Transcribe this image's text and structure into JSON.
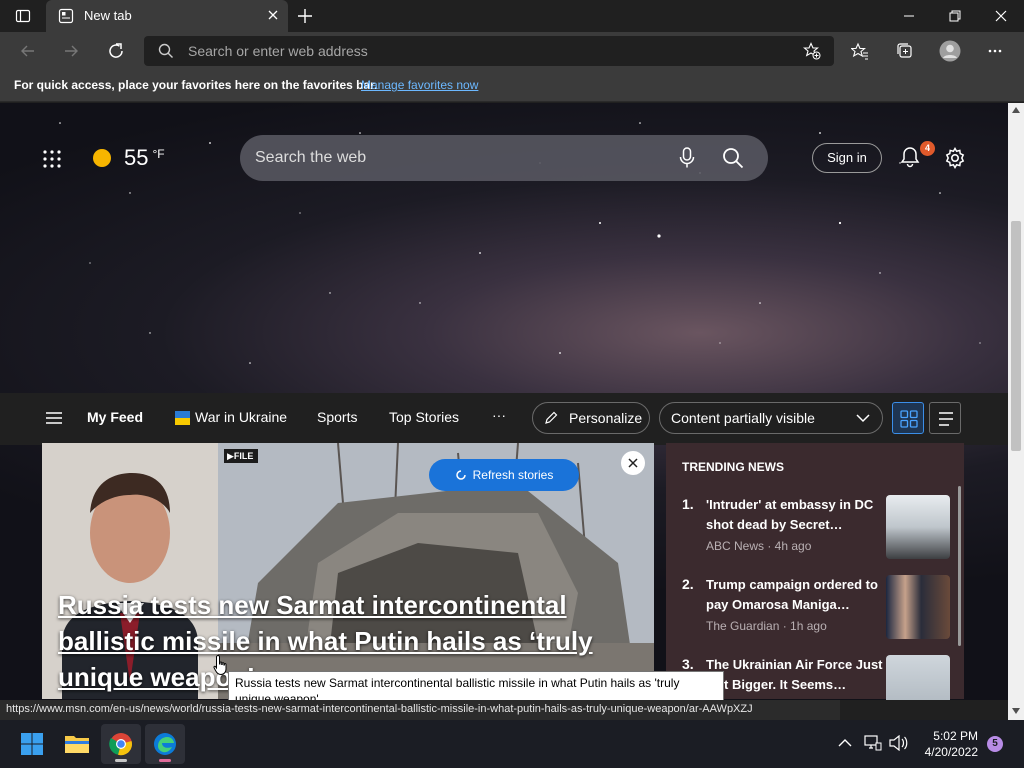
{
  "browser": {
    "tab_title": "New tab",
    "address_placeholder": "Search or enter web address",
    "favorites_message": "For quick access, place your favorites here on the favorites bar.",
    "favorites_link": "Manage favorites now"
  },
  "newtab": {
    "weather": {
      "temp": "55",
      "unit": "°F"
    },
    "search_placeholder": "Search the web",
    "signin_label": "Sign in",
    "notification_count": "4"
  },
  "feed_nav": {
    "items": [
      "My Feed",
      "War in Ukraine",
      "Sports",
      "Top Stories"
    ],
    "more": "···",
    "personalize": "Personalize",
    "content_filter": "Content partially visible"
  },
  "hero": {
    "file_tag": "▶FILE",
    "refresh_label": "Refresh stories",
    "headline": "Russia tests new Sarmat intercontinental ballistic missile in what Putin hails as ‘truly unique weapon’"
  },
  "trending": {
    "heading": "TRENDING NEWS",
    "items": [
      {
        "num": "1.",
        "title": "'Intruder' at embassy in DC shot dead by Secret…",
        "source": "ABC News · 4h ago"
      },
      {
        "num": "2.",
        "title": "Trump campaign ordered to pay Omarosa Maniga…",
        "source": "The Guardian · 1h ago"
      },
      {
        "num": "3.",
        "title": "The Ukrainian Air Force Just Got Bigger. It Seems…",
        "source": ""
      }
    ]
  },
  "tooltip": "Russia tests new Sarmat intercontinental ballistic missile in what Putin hails as 'truly unique weapon'",
  "status_url": "https://www.msn.com/en-us/news/world/russia-tests-new-sarmat-intercontinental-ballistic-missile-in-what-putin-hails-as-truly-unique-weapon/ar-AAWpXZJ",
  "taskbar": {
    "time": "5:02 PM",
    "date": "4/20/2022",
    "notifications": "5"
  }
}
